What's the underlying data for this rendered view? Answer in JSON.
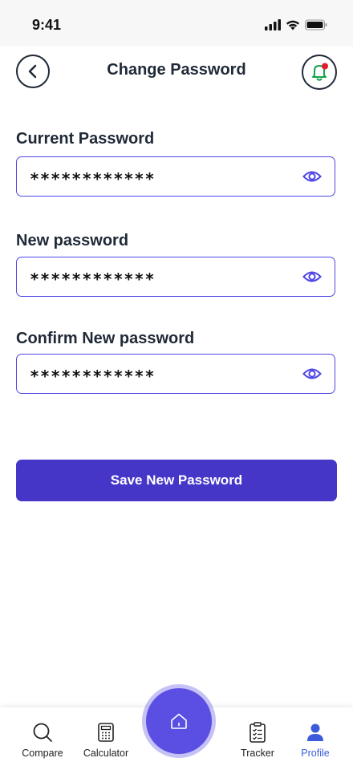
{
  "status": {
    "time": "9:41"
  },
  "header": {
    "title": "Change Password"
  },
  "form": {
    "current": {
      "label": "Current Password",
      "value": "************"
    },
    "new": {
      "label": "New password",
      "value": "************"
    },
    "confirm": {
      "label": "Confirm New password",
      "value": "************"
    },
    "save_label": "Save New Password"
  },
  "tabs": [
    {
      "label": "Compare",
      "icon": "search-icon"
    },
    {
      "label": "Calculator",
      "icon": "calculator-icon"
    },
    {
      "label": "Home",
      "icon": "home-icon"
    },
    {
      "label": "Tracker",
      "icon": "clipboard-icon"
    },
    {
      "label": "Profile",
      "icon": "user-icon"
    }
  ],
  "colors": {
    "accent": "#4f46e5",
    "button": "#4636c8",
    "active_tab": "#3b5bdb",
    "notification_dot": "#e11d2a",
    "bell": "#16a34a"
  }
}
